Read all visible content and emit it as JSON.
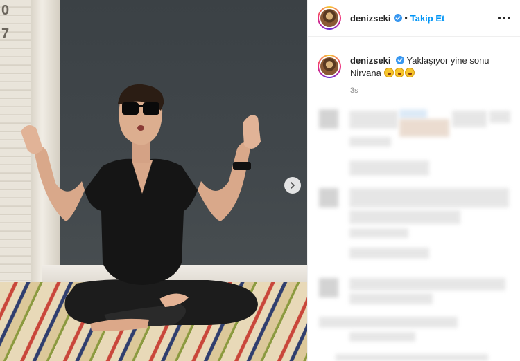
{
  "post": {
    "username": "denizseki",
    "follow_label": "Takip Et",
    "separator": "•",
    "caption_text": "Yaklaşıyor yine sonu Nirvana",
    "time": "3s",
    "emoji_count": 3
  },
  "photo": {
    "wall_numbers": [
      "0",
      "7"
    ]
  },
  "icons": {
    "verified": "verified-badge-icon",
    "more": "more-options-icon",
    "next": "chevron-right-icon"
  },
  "colors": {
    "follow": "#0095f6",
    "verified": "#3897f0",
    "timestamp": "#8e8e8e"
  }
}
